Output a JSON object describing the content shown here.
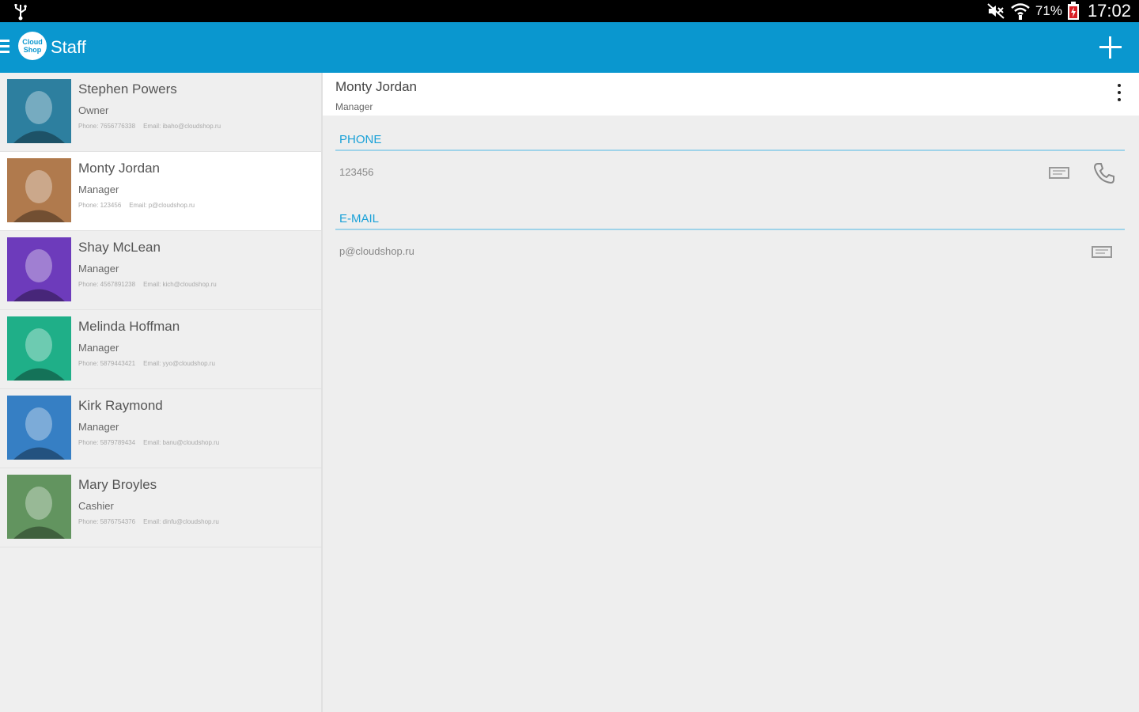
{
  "status_bar": {
    "battery_percent": "71%",
    "time": "17:02",
    "icons": [
      "usb-icon",
      "mute-icon",
      "wifi-icon",
      "battery-icon"
    ]
  },
  "action_bar": {
    "logo_text": "Cloud Shop",
    "title": "Staff",
    "icons": [
      "menu-icon",
      "add-icon"
    ]
  },
  "staff": [
    {
      "name": "Stephen Powers",
      "role": "Owner",
      "phone": "Phone: 7656776338",
      "email": "Email: ibaho@cloudshop.ru",
      "avatar_color": "#2f8fb5"
    },
    {
      "name": "Monty Jordan",
      "role": "Manager",
      "phone": "Phone: 123456",
      "email": "Email: p@cloudshop.ru",
      "avatar_color": "#c98a55"
    },
    {
      "name": "Shay McLean",
      "role": "Manager",
      "phone": "Phone: 4567891238",
      "email": "Email: kich@cloudshop.ru",
      "avatar_color": "#7a3fd6"
    },
    {
      "name": "Melinda Hoffman",
      "role": "Manager",
      "phone": "Phone: 5879443421",
      "email": "Email: yyo@cloudshop.ru",
      "avatar_color": "#1fc89a"
    },
    {
      "name": "Kirk Raymond",
      "role": "Manager",
      "phone": "Phone: 5879789434",
      "email": "Email: banu@cloudshop.ru",
      "avatar_color": "#3a8fe0"
    },
    {
      "name": "Mary Broyles",
      "role": "Cashier",
      "phone": "Phone: 5876754376",
      "email": "Email: dinfu@cloudshop.ru",
      "avatar_color": "#6da86a"
    }
  ],
  "detail": {
    "name": "Monty Jordan",
    "role": "Manager",
    "phone_label": "PHONE",
    "phone_value": "123456",
    "email_label": "E-MAIL",
    "email_value": "p@cloudshop.ru"
  },
  "colors": {
    "accent": "#0a97cf",
    "section_title": "#1aa1d8"
  }
}
